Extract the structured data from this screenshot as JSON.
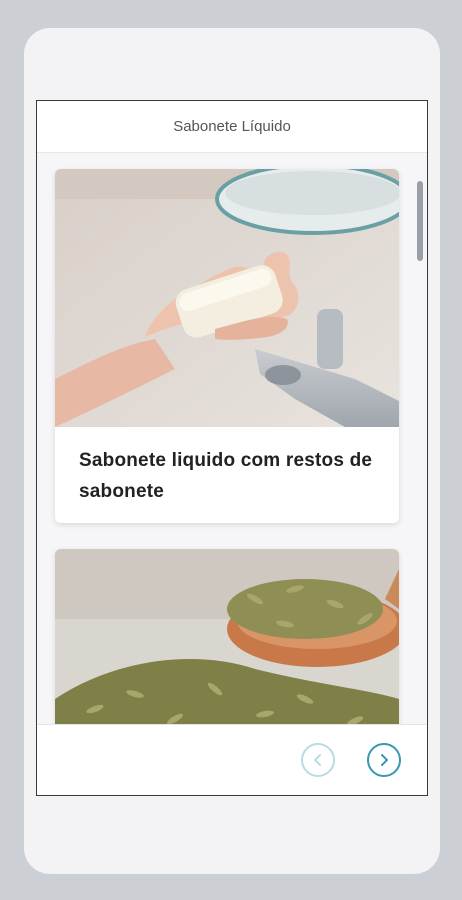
{
  "header": {
    "title": "Sabonete Líquido"
  },
  "cards": [
    {
      "title": "Sabonete liquido com restos de sabonete",
      "image_icon": "soap-bar-image"
    },
    {
      "title": "",
      "image_icon": "fennel-seeds-image"
    }
  ],
  "footer": {
    "prev_icon": "chevron-left-icon",
    "next_icon": "chevron-right-icon"
  },
  "colors": {
    "accent": "#3a97b2",
    "accent_disabled": "#b9dbe3"
  }
}
